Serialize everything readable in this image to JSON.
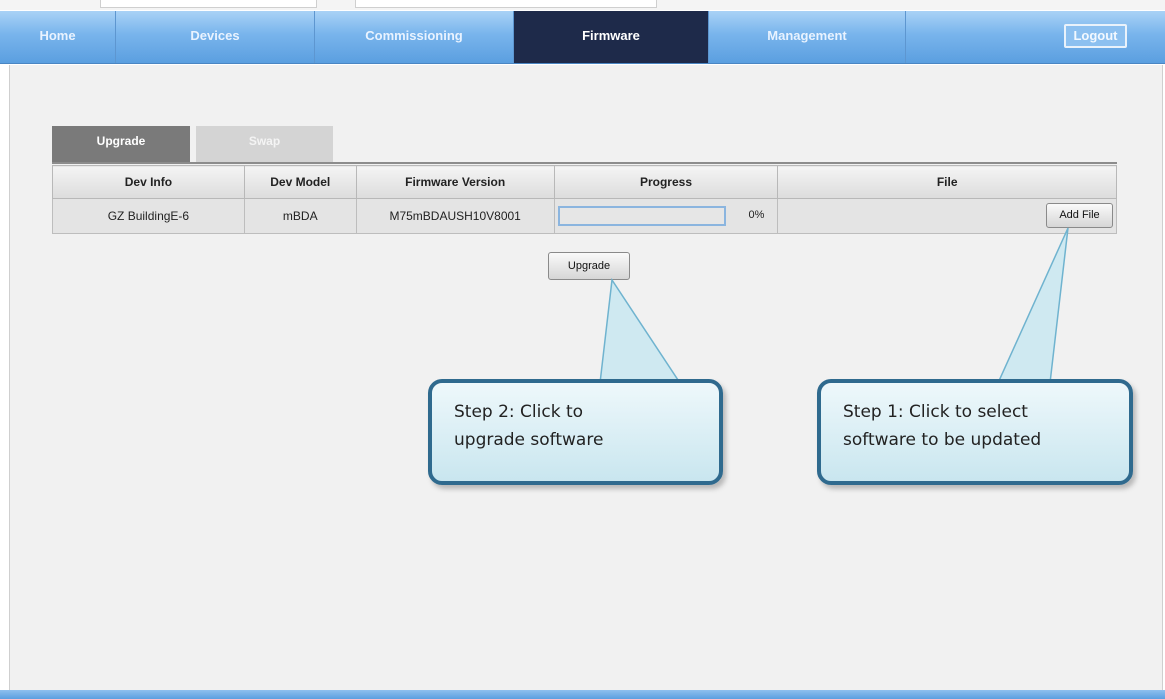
{
  "nav": {
    "items": [
      {
        "label": "Home",
        "active": false
      },
      {
        "label": "Devices",
        "active": false
      },
      {
        "label": "Commissioning",
        "active": false
      },
      {
        "label": "Firmware",
        "active": true
      },
      {
        "label": "Management",
        "active": false
      }
    ],
    "logout_label": "Logout"
  },
  "tabs": [
    {
      "label": "Upgrade",
      "active": true
    },
    {
      "label": "Swap",
      "active": false
    }
  ],
  "table": {
    "headers": [
      "Dev Info",
      "Dev Model",
      "Firmware Version",
      "Progress",
      "File"
    ],
    "rows": [
      {
        "dev_info": "GZ BuildingE-6",
        "dev_model": "mBDA",
        "firmware_version": "M75mBDAUSH10V8001",
        "progress": 0,
        "progress_text": "0%",
        "file_button": "Add File"
      }
    ]
  },
  "upgrade_button": "Upgrade",
  "callouts": {
    "step2": {
      "line1": "Step 2: Click to",
      "line2": "upgrade software"
    },
    "step1": {
      "line1": "Step 1: Click to select",
      "line2": "software to be updated"
    }
  },
  "colors": {
    "nav_active": "#1e2a4a",
    "nav_bar": "#78b4ec",
    "progress_border": "#8bb5df",
    "callout_border": "#2f6a8e"
  }
}
